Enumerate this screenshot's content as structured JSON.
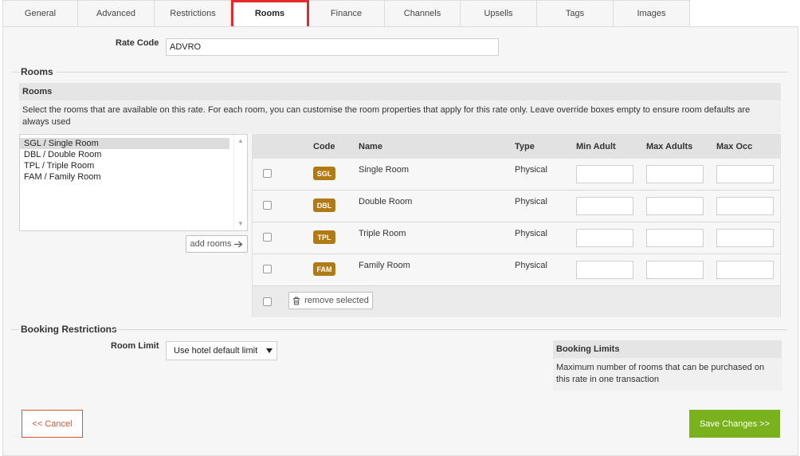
{
  "tabs": [
    {
      "label": "General",
      "active": false
    },
    {
      "label": "Advanced",
      "active": false
    },
    {
      "label": "Restrictions",
      "active": false
    },
    {
      "label": "Rooms",
      "active": true
    },
    {
      "label": "Finance",
      "active": false
    },
    {
      "label": "Channels",
      "active": false
    },
    {
      "label": "Upsells",
      "active": false
    },
    {
      "label": "Tags",
      "active": false
    },
    {
      "label": "Images",
      "active": false
    }
  ],
  "rate_code": {
    "label": "Rate Code",
    "value": "ADVRO"
  },
  "rooms_section": {
    "heading": "Rooms",
    "info_title": "Rooms",
    "info_text": "Select the rooms that are available on this rate. For each room, you can customise the room properties that apply for this rate only. Leave override boxes empty to ensure room defaults are always used",
    "available_rooms": [
      "SGL / Single Room",
      "DBL / Double Room",
      "TPL / Triple Room",
      "FAM / Family Room"
    ],
    "add_rooms_label": "add rooms",
    "columns": {
      "code": "Code",
      "name": "Name",
      "type": "Type",
      "min_adult": "Min Adult",
      "max_adults": "Max Adults",
      "max_occ": "Max Occ"
    },
    "rows": [
      {
        "code": "SGL",
        "name": "Single Room",
        "type": "Physical",
        "min_adult": "",
        "max_adults": "",
        "max_occ": ""
      },
      {
        "code": "DBL",
        "name": "Double Room",
        "type": "Physical",
        "min_adult": "",
        "max_adults": "",
        "max_occ": ""
      },
      {
        "code": "TPL",
        "name": "Triple Room",
        "type": "Physical",
        "min_adult": "",
        "max_adults": "",
        "max_occ": ""
      },
      {
        "code": "FAM",
        "name": "Family Room",
        "type": "Physical",
        "min_adult": "",
        "max_adults": "",
        "max_occ": ""
      }
    ],
    "remove_selected_label": "remove selected"
  },
  "booking_restrictions": {
    "heading": "Booking Restrictions",
    "room_limit_label": "Room Limit",
    "room_limit_value": "Use hotel default limit",
    "info_title": "Booking Limits",
    "info_text": "Maximum number of rooms that can be purchased on this rate in one transaction"
  },
  "footer": {
    "cancel_label": "<< Cancel",
    "save_label": "Save Changes >>"
  },
  "colors": {
    "active_tab_highlight": "#e22a2a",
    "code_badge": "#b07a15",
    "save_button": "#7ab21d",
    "cancel_button": "#d9542a"
  },
  "icons": [
    "arrow-right-icon",
    "trash-icon",
    "chevron-down-icon"
  ]
}
